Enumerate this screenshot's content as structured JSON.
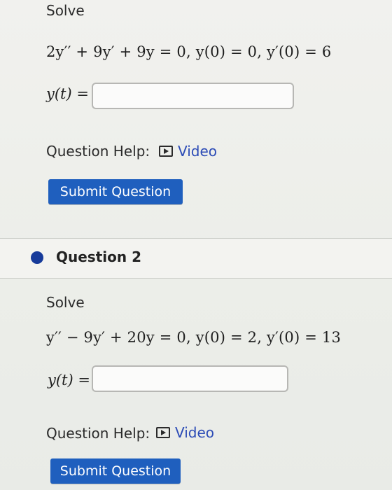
{
  "colors": {
    "accent": "#1f5fbe",
    "link": "#2b4bb6",
    "question_dot": "#163a9a"
  },
  "question1": {
    "instruction": "Solve",
    "equation": "2y′′ + 9y′ + 9y = 0,  y(0) = 0,  y′(0) = 6",
    "answer_label": "y(t) =",
    "answer_value": "",
    "help_label": "Question Help:",
    "video_label": "Video",
    "video_icon": "play-icon",
    "submit_label": "Submit Question"
  },
  "question2": {
    "header": "Question 2",
    "instruction": "Solve",
    "equation": "y′′ − 9y′ + 20y = 0,  y(0) = 2,  y′(0) = 13",
    "answer_label": "y(t) =",
    "answer_value": "",
    "help_label": "Question Help:",
    "video_label": "Video",
    "video_icon": "play-icon",
    "submit_label": "Submit Question"
  }
}
